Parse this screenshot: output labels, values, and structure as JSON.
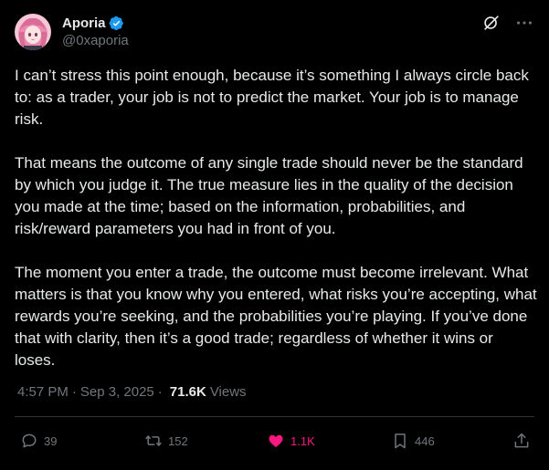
{
  "author": {
    "display_name": "Aporia",
    "handle": "@0xaporia",
    "verified": true,
    "avatar_icon": "anime-avatar-pink-hair"
  },
  "tweet": {
    "paragraphs": [
      "I can’t stress this point enough, because it’s something I always circle back to: as a trader, your job is not to predict the market. Your job is to manage risk.",
      "That means the outcome of any single trade should never be the standard by which you judge it. The true measure lies in the quality of the decision you made at the time; based on the information, probabilities, and risk/reward parameters you had in front of you.",
      "The moment you enter a trade, the outcome must become irrelevant. What matters is that you know why you entered, what risks you’re accepting, what rewards you’re seeking, and the probabilities you’re playing. If you’ve done that with clarity, then it’s a good trade; regardless of whether it wins or loses."
    ],
    "time": "4:57 PM",
    "separator": "·",
    "date": "Sep 3, 2025",
    "views_count": "71.6K",
    "views_label": "Views"
  },
  "actions": {
    "replies": "39",
    "reposts": "152",
    "likes": "1.1K",
    "bookmarks": "446"
  },
  "colors": {
    "background": "#000000",
    "text": "#e7e9ea",
    "muted": "#71767b",
    "verified": "#1d9bf0",
    "like": "#f91880",
    "divider": "#2f3336"
  }
}
